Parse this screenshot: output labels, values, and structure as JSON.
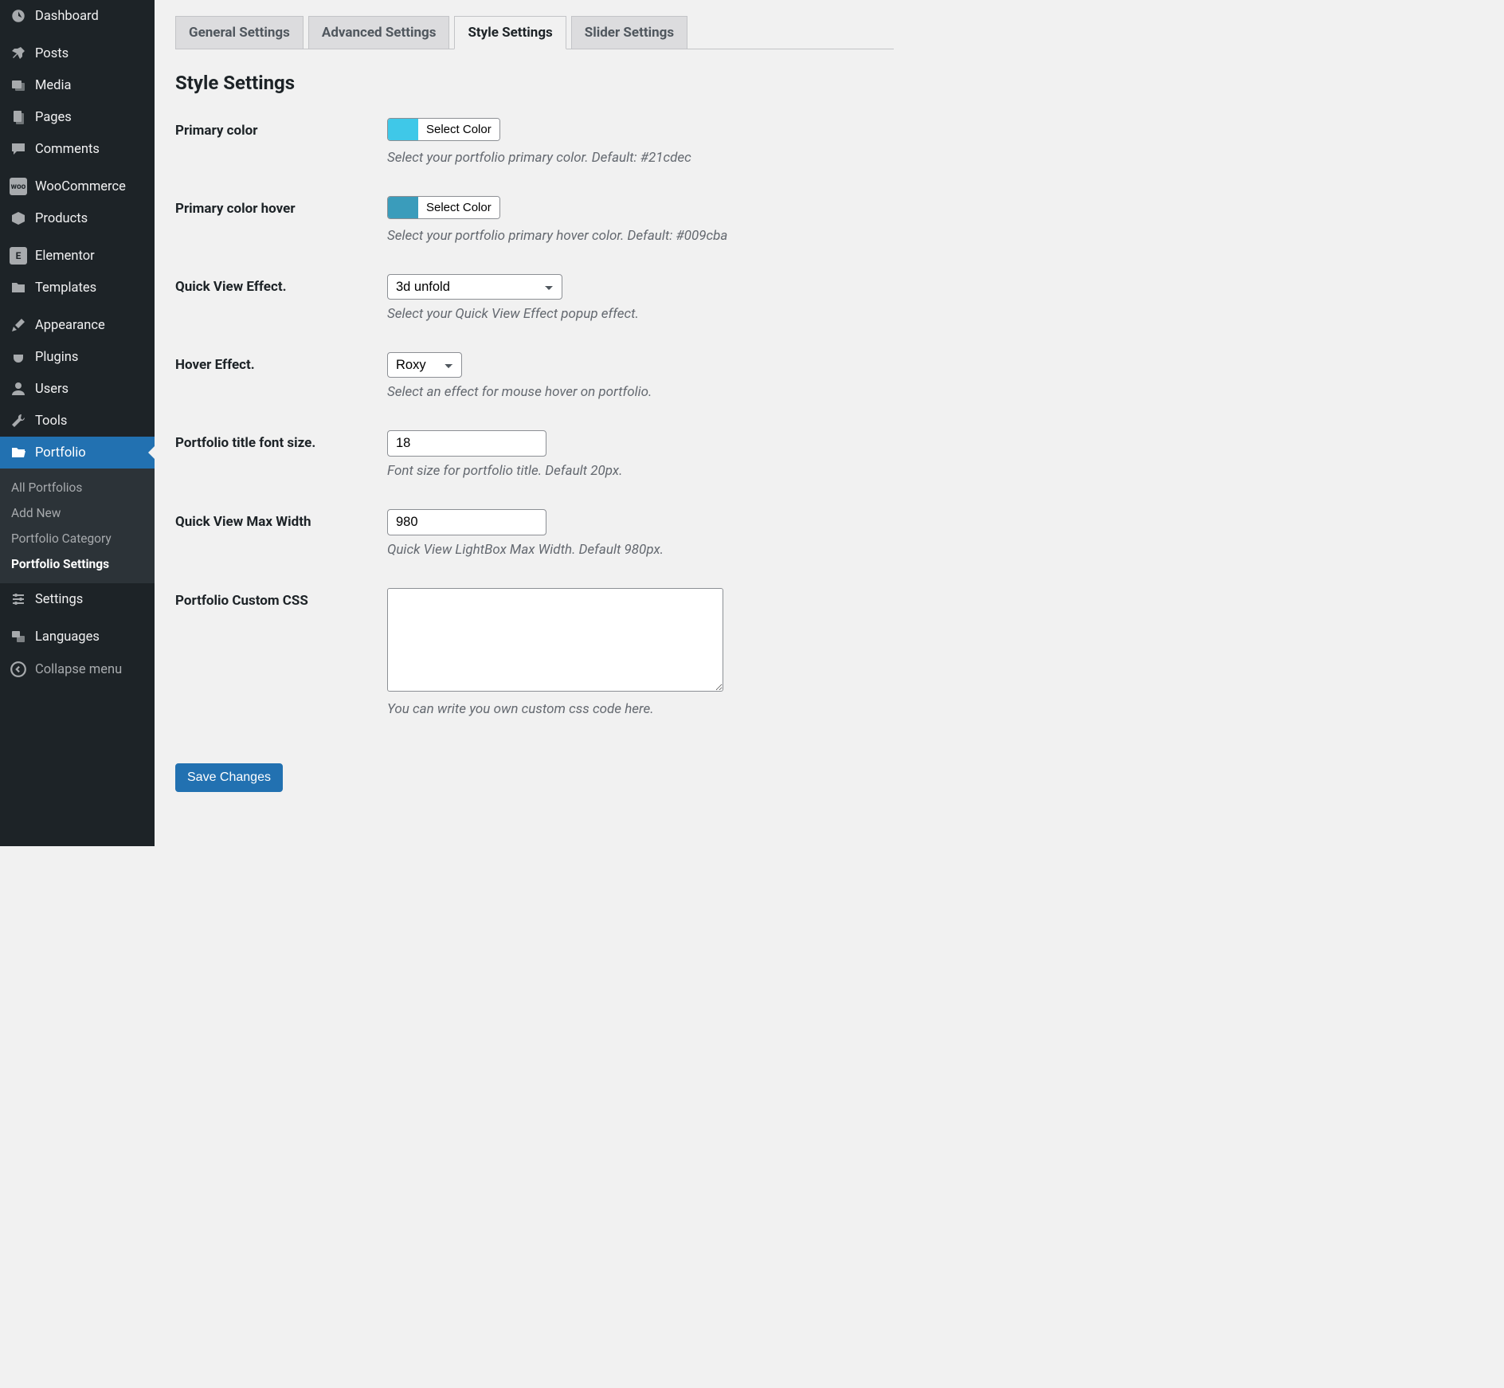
{
  "sidebar": {
    "items": [
      {
        "label": "Dashboard"
      },
      {
        "label": "Posts"
      },
      {
        "label": "Media"
      },
      {
        "label": "Pages"
      },
      {
        "label": "Comments"
      },
      {
        "label": "WooCommerce"
      },
      {
        "label": "Products"
      },
      {
        "label": "Elementor"
      },
      {
        "label": "Templates"
      },
      {
        "label": "Appearance"
      },
      {
        "label": "Plugins"
      },
      {
        "label": "Users"
      },
      {
        "label": "Tools"
      },
      {
        "label": "Portfolio"
      },
      {
        "label": "Settings"
      },
      {
        "label": "Languages"
      }
    ],
    "submenu": [
      {
        "label": "All Portfolios"
      },
      {
        "label": "Add New"
      },
      {
        "label": "Portfolio Category"
      },
      {
        "label": "Portfolio Settings"
      }
    ],
    "collapse": "Collapse menu"
  },
  "tabs": [
    {
      "label": "General Settings"
    },
    {
      "label": "Advanced Settings"
    },
    {
      "label": "Style Settings"
    },
    {
      "label": "Slider Settings"
    }
  ],
  "page_title": "Style Settings",
  "fields": {
    "primary_color": {
      "label": "Primary color",
      "button": "Select Color",
      "swatch": "#3fc8e8",
      "desc": "Select your portfolio primary color. Default: #21cdec"
    },
    "primary_hover": {
      "label": "Primary color hover",
      "button": "Select Color",
      "swatch": "#3a9cbb",
      "desc": "Select your portfolio primary hover color. Default: #009cba"
    },
    "quick_view": {
      "label": "Quick View Effect.",
      "value": "3d unfold",
      "desc": "Select your Quick View Effect popup effect."
    },
    "hover": {
      "label": "Hover Effect.",
      "value": "Roxy",
      "desc": "Select an effect for mouse hover on portfolio."
    },
    "title_size": {
      "label": "Portfolio title font size.",
      "value": "18",
      "desc": "Font size for portfolio title. Default 20px."
    },
    "max_width": {
      "label": "Quick View Max Width",
      "value": "980",
      "desc": "Quick View LightBox Max Width. Default 980px."
    },
    "custom_css": {
      "label": "Portfolio Custom CSS",
      "value": "",
      "desc": "You can write you own custom css code here."
    }
  },
  "save_label": "Save Changes"
}
